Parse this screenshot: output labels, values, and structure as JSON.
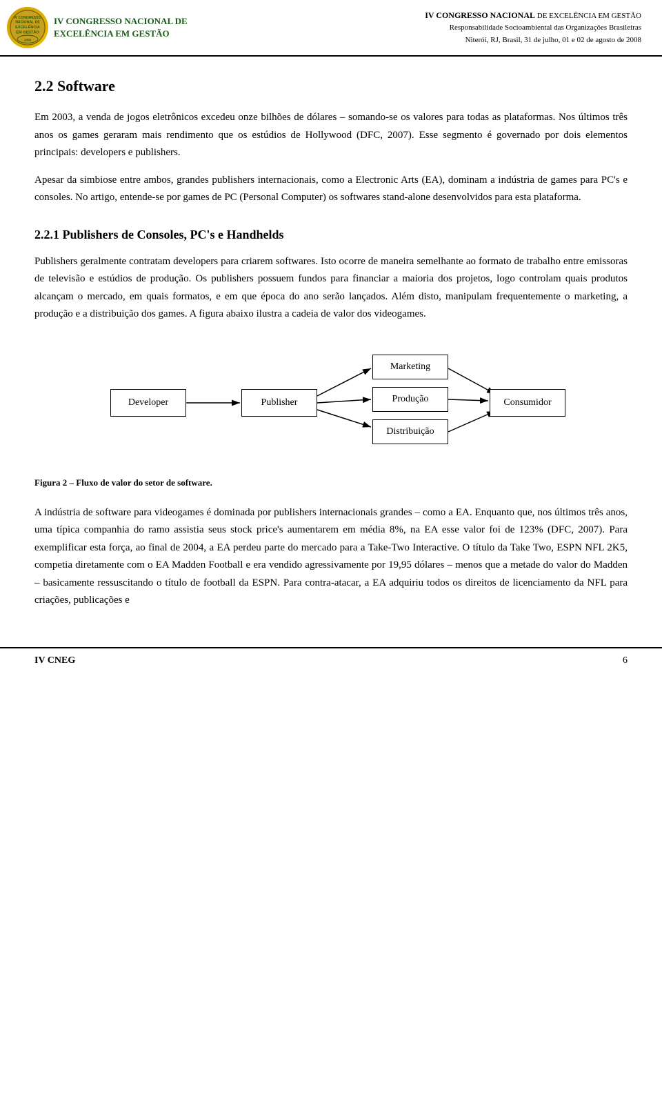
{
  "header": {
    "logo_line1": "IV CONGRESSO NACIONAL DE",
    "logo_line2": "EXCELÊNCIA EM GESTÃO",
    "title_bold": "IV CONGRESSO NACIONAL",
    "title_rest": " DE EXCELÊNCIA EM GESTÃO",
    "subtitle1": "Responsabilidade Socioambiental das Organizações Brasileiras",
    "subtitle2": "Niterói, RJ, Brasil, 31 de julho, 01 e 02 de agosto de 2008"
  },
  "section": {
    "heading": "2.2 Software",
    "paragraph1": "Em 2003, a venda de jogos eletrônicos excedeu onze bilhões de dólares – somando-se os valores para todas as plataformas. Nos últimos três anos os games geraram mais rendimento que os estúdios de Hollywood (DFC, 2007). Esse segmento é governado por dois elementos principais: developers e publishers.",
    "paragraph2": "Apesar da simbiose entre ambos, grandes publishers internacionais, como a Electronic Arts (EA), dominam a indústria de games para PC's e consoles. No artigo, entende-se por games de PC (Personal Computer) os softwares stand-alone desenvolvidos para esta plataforma.",
    "subsection_heading": "2.2.1 Publishers de Consoles, PC's e Handhelds",
    "paragraph3": "Publishers geralmente contratam developers para criarem softwares. Isto ocorre de maneira semelhante ao formato de trabalho entre emissoras de televisão e estúdios de produção. Os publishers possuem fundos para financiar a maioria dos projetos, logo controlam quais produtos alcançam o mercado, em quais formatos, e em que época do ano serão lançados. Além disto, manipulam frequentemente o marketing, a produção e a distribuição dos games. A figura abaixo ilustra a cadeia de valor dos videogames.",
    "diagram": {
      "developer_label": "Developer",
      "publisher_label": "Publisher",
      "marketing_label": "Marketing",
      "producao_label": "Produção",
      "distribuicao_label": "Distribuição",
      "consumidor_label": "Consumidor"
    },
    "figure_caption": "Figura 2 – Fluxo de valor do setor de software.",
    "paragraph4": "A indústria de software para videogames é dominada por publishers internacionais grandes – como a EA. Enquanto que, nos últimos três anos, uma típica companhia do ramo assistia seus stock price's aumentarem em média 8%, na EA esse valor foi de 123% (DFC, 2007). Para exemplificar esta força, ao final de 2004, a EA perdeu parte do mercado para a Take-Two Interactive. O título da Take Two, ESPN NFL 2K5, competia diretamente com o EA Madden Football e era vendido agressivamente por 19,95 dólares – menos que a metade do valor do Madden – basicamente ressuscitando o título de football da ESPN. Para contra-atacar, a EA adquiriu todos os direitos de licenciamento da NFL para criações, publicações e"
  },
  "footer": {
    "left": "IV CNEG",
    "right": "6"
  }
}
